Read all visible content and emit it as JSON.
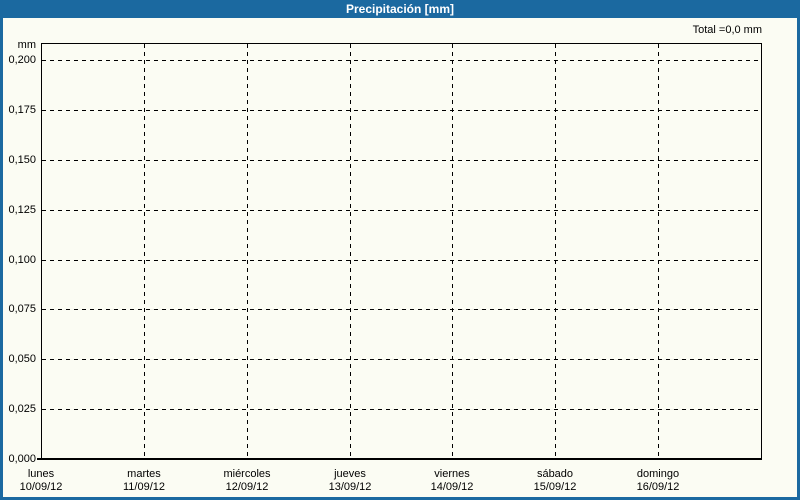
{
  "header": {
    "title": "Precipitación [mm]"
  },
  "summary": {
    "total_label": "Total =0,0 mm"
  },
  "y_axis": {
    "unit_label": "mm",
    "ticks": [
      {
        "value": 0.0,
        "label": "0,000"
      },
      {
        "value": 0.025,
        "label": "0,025"
      },
      {
        "value": 0.05,
        "label": "0,050"
      },
      {
        "value": 0.075,
        "label": "0,075"
      },
      {
        "value": 0.1,
        "label": "0,100"
      },
      {
        "value": 0.125,
        "label": "0,125"
      },
      {
        "value": 0.15,
        "label": "0,150"
      },
      {
        "value": 0.175,
        "label": "0,175"
      },
      {
        "value": 0.2,
        "label": "0,200"
      }
    ]
  },
  "x_axis": {
    "days": [
      {
        "name": "lunes",
        "date": "10/09/12"
      },
      {
        "name": "martes",
        "date": "11/09/12"
      },
      {
        "name": "miércoles",
        "date": "12/09/12"
      },
      {
        "name": "jueves",
        "date": "13/09/12"
      },
      {
        "name": "viernes",
        "date": "14/09/12"
      },
      {
        "name": "sábado",
        "date": "15/09/12"
      },
      {
        "name": "domingo",
        "date": "16/09/12"
      }
    ]
  },
  "chart_data": {
    "type": "bar",
    "title": "Precipitación [mm]",
    "ylabel": "mm",
    "xlabel": "",
    "categories": [
      "lunes 10/09/12",
      "martes 11/09/12",
      "miércoles 12/09/12",
      "jueves 13/09/12",
      "viernes 14/09/12",
      "sábado 15/09/12",
      "domingo 16/09/12"
    ],
    "values": [
      0,
      0,
      0,
      0,
      0,
      0,
      0
    ],
    "total_label": "Total =0,0 mm",
    "total_mm": 0.0,
    "ylim": [
      0,
      0.2085
    ],
    "yticks": [
      0,
      0.025,
      0.05,
      0.075,
      0.1,
      0.125,
      0.15,
      0.175,
      0.2
    ],
    "grid": "dashed horizontal and vertical",
    "legend": "none",
    "decimal_separator": ","
  },
  "colors": {
    "header_bg": "#1b69a0",
    "frame_border": "#1b69a0",
    "header_text": "#ffffff",
    "plot_background": "#fbfcf3",
    "grid_line": "#000000",
    "axis_line": "#000000",
    "label_text": "#000000"
  }
}
